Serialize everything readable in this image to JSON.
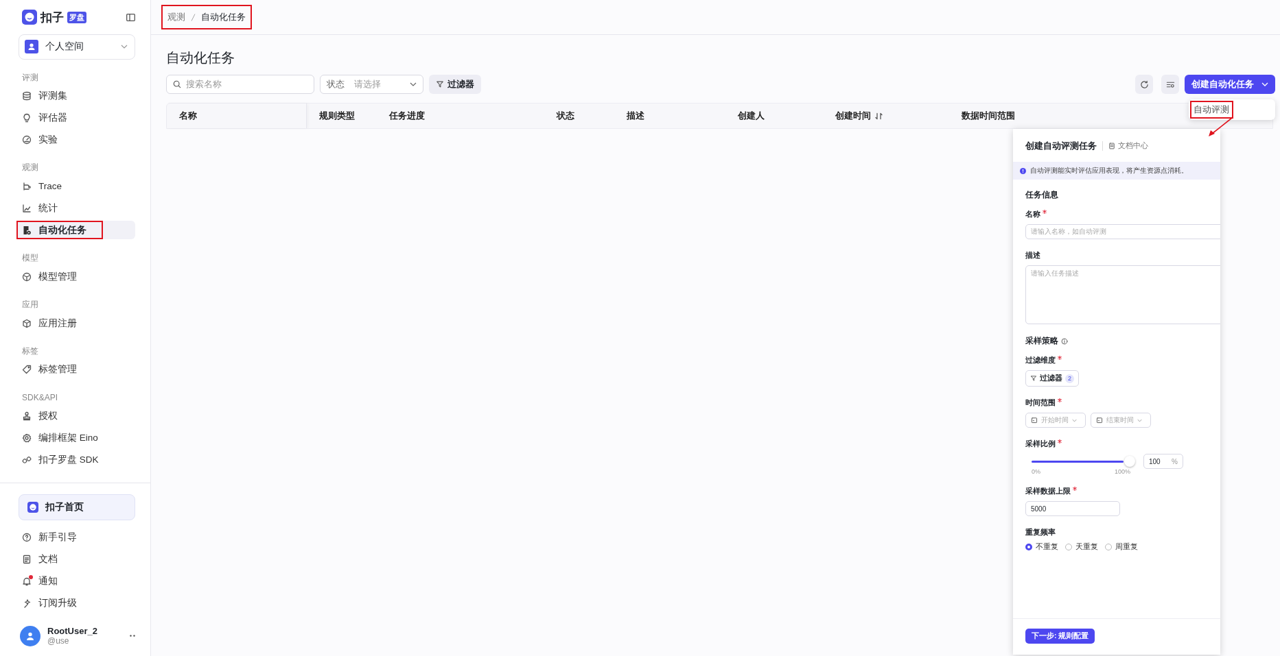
{
  "logo": {
    "name": "扣子",
    "badge": "罗盘"
  },
  "workspace": {
    "label": "个人空间"
  },
  "nav_sections": [
    {
      "title": "评测",
      "items": [
        {
          "label": "评测集",
          "selected": false,
          "highlighted": false
        },
        {
          "label": "评估器",
          "selected": false,
          "highlighted": false
        },
        {
          "label": "实验",
          "selected": false,
          "highlighted": false
        }
      ]
    },
    {
      "title": "观测",
      "items": [
        {
          "label": "Trace",
          "selected": false,
          "highlighted": false
        },
        {
          "label": "统计",
          "selected": false,
          "highlighted": false
        },
        {
          "label": "自动化任务",
          "selected": true,
          "highlighted": true
        }
      ]
    },
    {
      "title": "模型",
      "items": [
        {
          "label": "模型管理",
          "selected": false,
          "highlighted": false
        }
      ]
    },
    {
      "title": "应用",
      "items": [
        {
          "label": "应用注册",
          "selected": false,
          "highlighted": false
        }
      ]
    },
    {
      "title": "标签",
      "items": [
        {
          "label": "标签管理",
          "selected": false,
          "highlighted": false
        }
      ]
    },
    {
      "title": "SDK&API",
      "items": [
        {
          "label": "授权",
          "selected": false,
          "highlighted": false
        },
        {
          "label": "编排框架 Eino",
          "selected": false,
          "highlighted": false
        },
        {
          "label": "扣子罗盘 SDK",
          "selected": false,
          "highlighted": false
        }
      ]
    }
  ],
  "home_button": "扣子首页",
  "footer_items": [
    {
      "label": "新手引导",
      "unread": false
    },
    {
      "label": "文档",
      "unread": false
    },
    {
      "label": "通知",
      "unread": true
    },
    {
      "label": "订阅升级",
      "unread": false
    }
  ],
  "user": {
    "name": "RootUser_2",
    "handle": "@use"
  },
  "breadcrumb": {
    "items": [
      "观测",
      "自动化任务"
    ],
    "highlighted": true
  },
  "page_title": "自动化任务",
  "toolbar": {
    "search_placeholder": "搜索名称",
    "status_label": "状态",
    "status_placeholder": "请选择",
    "filter_button": "过滤器",
    "create_button": "创建自动化任务"
  },
  "table": {
    "columns": [
      {
        "label": "名称",
        "sortable": false
      },
      {
        "label": "规则类型",
        "sortable": false
      },
      {
        "label": "任务进度",
        "sortable": false
      },
      {
        "label": "状态",
        "sortable": false
      },
      {
        "label": "描述",
        "sortable": false
      },
      {
        "label": "创建人",
        "sortable": false
      },
      {
        "label": "创建时间",
        "sortable": true
      },
      {
        "label": "数据时间范围",
        "sortable": false
      }
    ]
  },
  "create_menu": {
    "items": [
      {
        "label": "自动评测",
        "highlighted": true
      }
    ]
  },
  "panel": {
    "title": "创建自动评测任务",
    "doc_link": "文档中心",
    "notice": "自动评测能实时评估应用表现，将产生资源点消耗。",
    "task_section": "任务信息",
    "name_field": {
      "label": "名称",
      "required": true,
      "placeholder": "请输入名称，如自动评测"
    },
    "desc_field": {
      "label": "描述",
      "required": false,
      "placeholder": "请输入任务描述"
    },
    "sampling_section": "采样策略",
    "filter_field": {
      "label": "过滤维度",
      "required": true,
      "button": "过滤器",
      "count": "2"
    },
    "time_field": {
      "label": "时间范围",
      "required": true,
      "start": "开始时间",
      "end": "结束时间"
    },
    "ratio_field": {
      "label": "采样比例",
      "required": true,
      "level": 1,
      "min": "0%",
      "max": "100%",
      "value": "100",
      "unit": "%"
    },
    "limit_field": {
      "label": "采样数据上限",
      "required": true,
      "value": "5000"
    },
    "repeat_field": {
      "label": "重复频率",
      "required": false,
      "options": [
        {
          "label": "不重复",
          "selected": true
        },
        {
          "label": "天重复",
          "selected": false
        },
        {
          "label": "周重复",
          "selected": false
        }
      ]
    },
    "next_button": "下一步: 规则配置"
  }
}
